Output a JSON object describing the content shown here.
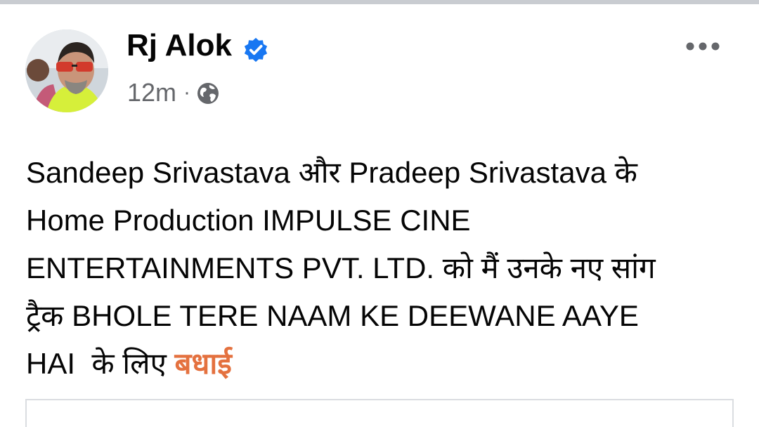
{
  "post": {
    "author": "Rj Alok",
    "verified_color": "#1877f2",
    "timestamp": "12m",
    "separator": "·",
    "audience_icon": "globe-icon",
    "more_icon": "more-horizontal-icon",
    "body_lines": [
      "Sandeep Srivastava और Pradeep Srivastava के",
      "Home Production IMPULSE CINE",
      "ENTERTAINMENTS PVT. LTD. को मैं उनके नए सांग",
      "ट्रैक BHOLE TERE NAAM KE DEEWANE AAYE"
    ],
    "last_line_prefix": "HAI  के लिए ",
    "highlight": "बधाई",
    "highlight_color": "#e4713f"
  }
}
